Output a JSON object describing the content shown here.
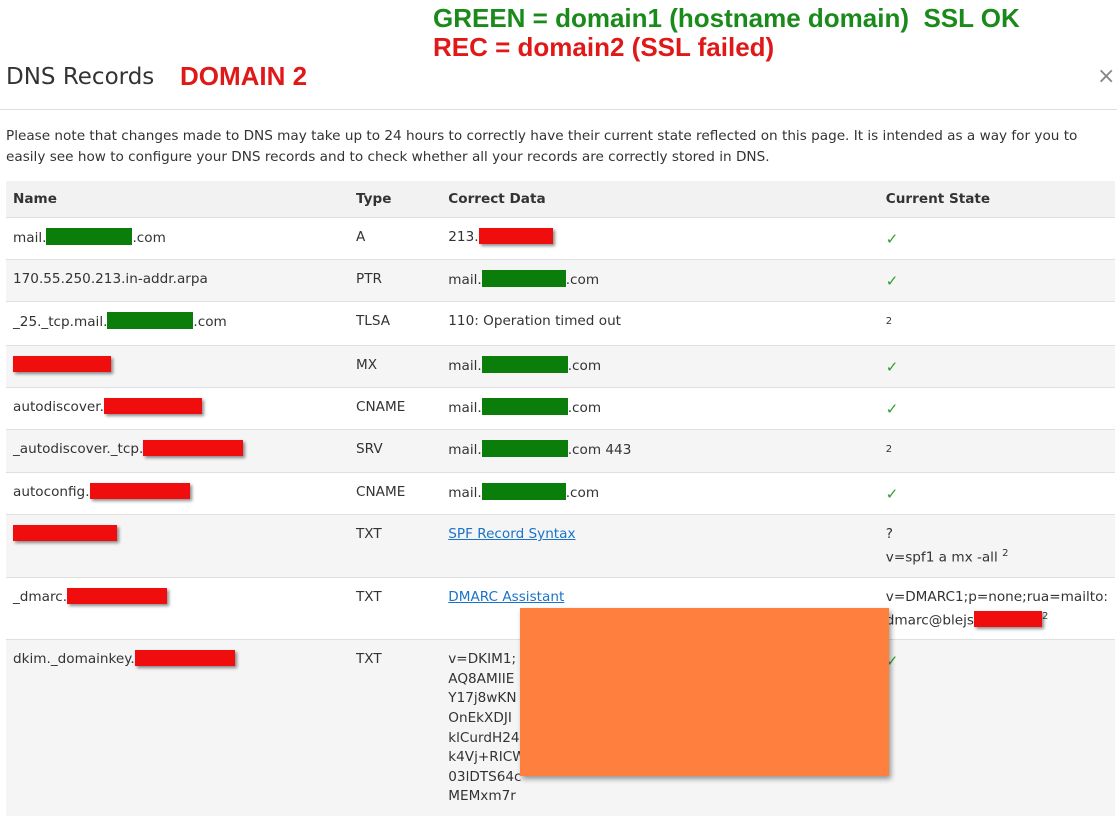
{
  "annotation": {
    "green_line": "GREEN = domain1 (hostname domain)  SSL OK",
    "red_line": "REC = domain2 (SSL failed)"
  },
  "dialog": {
    "title": "DNS Records",
    "domain_label": "DOMAIN 2",
    "close_glyph": "×",
    "note": "Please note that changes made to DNS may take up to 24 hours to correctly have their current state reflected on this page. It is intended as a way for you to easily see how to configure your DNS records and to check whether all your records are correctly stored in DNS."
  },
  "table": {
    "headers": [
      "Name",
      "Type",
      "Correct Data",
      "Current State"
    ],
    "rows": [
      {
        "name_pre": "mail.",
        "name_post": ".com",
        "type": "A",
        "data_pre": "213.",
        "data_post": "",
        "check": "✓"
      },
      {
        "name_pre": "170.55.250.213.in-addr.arpa",
        "name_post": "",
        "type": "PTR",
        "data_pre": "mail.",
        "data_post": ".com",
        "check": "✓"
      },
      {
        "name_pre": "_25._tcp.mail.",
        "name_post": ".com",
        "type": "TLSA",
        "data_pre": "110: Operation timed out",
        "data_post": "",
        "state_sup": "2"
      },
      {
        "name_pre": "",
        "name_post": "",
        "type": "MX",
        "data_pre": "mail.",
        "data_post": ".com",
        "check": "✓"
      },
      {
        "name_pre": "autodiscover.",
        "name_post": "",
        "type": "CNAME",
        "data_pre": "mail.",
        "data_post": ".com",
        "check": "✓"
      },
      {
        "name_pre": "_autodiscover._tcp.",
        "name_post": "",
        "type": "SRV",
        "data_pre": "mail.",
        "data_post": ".com 443",
        "state_sup": "2"
      },
      {
        "name_pre": "autoconfig.",
        "name_post": "",
        "type": "CNAME",
        "data_pre": "mail.",
        "data_post": ".com",
        "check": "✓"
      },
      {
        "name_pre": "",
        "name_post": "",
        "type": "TXT",
        "link": "SPF Record Syntax",
        "state_line1": "?",
        "state_line2": "v=spf1 a mx -all",
        "state_sup": "2"
      },
      {
        "name_pre": "_dmarc.",
        "name_post": "",
        "type": "TXT",
        "link": "DMARC Assistant",
        "state_line1": "v=DMARC1;p=none;rua=mailto:",
        "state_line2": "dmarc@blejs",
        "state_sup": "2"
      },
      {
        "name_pre": "dkim._domainkey.",
        "name_post": "",
        "type": "TXT",
        "dkim_lines": [
          "v=DKIM1;",
          "AQ8AMIIE",
          "Y17j8wKN",
          "OnEkXDJI",
          "klCurdH24",
          "k4Vj+RICW",
          "03lDTS64c",
          "MEMxm7r"
        ],
        "check": "✓"
      }
    ]
  },
  "colors": {
    "annotation_green": "#1a8a1a",
    "annotation_red": "#e01818",
    "redact_green": "#0b7d0b",
    "redact_red": "#f00d0d",
    "redact_orange": "#ff7f3f",
    "check_green": "#2e9e2e",
    "link_blue": "#1a73c8"
  },
  "icons": {
    "close": "close-icon",
    "check": "checkmark-icon"
  }
}
